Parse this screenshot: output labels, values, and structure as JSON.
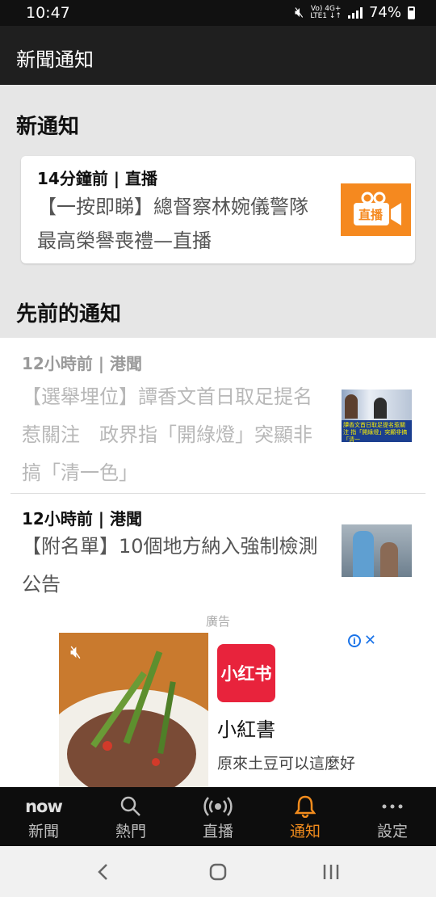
{
  "status_bar": {
    "time": "10:47",
    "network_top": "Vo) 4G+",
    "network_bottom": "LTE1 ↓↑",
    "battery": "74%"
  },
  "app_bar": {
    "title": "新聞通知"
  },
  "new_section": {
    "title": "新通知",
    "card": {
      "meta": "14分鐘前 | 直播",
      "headline": "【一按即睇】總督察林婉儀警隊最高榮譽喪禮—直播",
      "thumbnail_text": "直播"
    }
  },
  "previous_section": {
    "title": "先前的通知",
    "items": [
      {
        "meta": "12小時前 | 港聞",
        "headline": "【選舉埋位】譚香文首日取足提名惹關注　政界指「開綠燈」突顯非搞「清一色」",
        "thumb_caption": "譚香文首日取足提名惹關注 指「開綠燈」突顯非搞「清一"
      },
      {
        "meta": "12小時前 | 港聞",
        "headline": "【附名單】10個地方納入強制檢測公告"
      }
    ]
  },
  "ad": {
    "label": "廣告",
    "logo_text": "小红书",
    "name": "小紅書",
    "description": "原來土豆可以這麼好"
  },
  "tab_bar": {
    "tabs": [
      {
        "label": "新聞",
        "icon": "now-logo-icon",
        "logo_text": "now"
      },
      {
        "label": "熱門",
        "icon": "search-icon"
      },
      {
        "label": "直播",
        "icon": "broadcast-icon"
      },
      {
        "label": "通知",
        "icon": "bell-icon"
      },
      {
        "label": "設定",
        "icon": "more-dots-icon"
      }
    ],
    "active_tab": "通知"
  },
  "colors": {
    "accent": "#f28c1d",
    "app_bar": "#1f1f1f",
    "background": "#e6e6e6",
    "ad_logo": "#e8233c"
  }
}
